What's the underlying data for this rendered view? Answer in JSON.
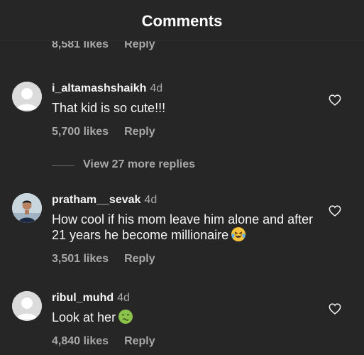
{
  "header": {
    "title": "Comments"
  },
  "top_comment_meta": {
    "likes": "8,581 likes",
    "reply": "Reply"
  },
  "comments": [
    {
      "username": "i_altamashshaikh",
      "time": "4d",
      "text": "That kid is so cute!!!",
      "likes": "5,700 likes",
      "reply": "Reply",
      "avatar": "default-avatar-icon"
    },
    {
      "username": "pratham__sevak",
      "time": "4d",
      "text": "How cool if his mom leave him alone and after 21 years he become millionaire",
      "emoji": "laughing-tears-emoji",
      "likes": "3,501 likes",
      "reply": "Reply",
      "avatar": "profile-photo"
    },
    {
      "username": "ribul_muhd",
      "time": "4d",
      "text": "Look at her",
      "emoji": "nauseated-face-emoji",
      "likes": "4,840 likes",
      "reply": "Reply",
      "avatar": "default-avatar-icon"
    }
  ],
  "view_replies": {
    "label": "View 27 more replies"
  },
  "icons": {
    "like": "heart-outline-icon"
  },
  "colors": {
    "background": "#262626",
    "text": "#f5f5f5",
    "muted": "#a8a8a8"
  }
}
